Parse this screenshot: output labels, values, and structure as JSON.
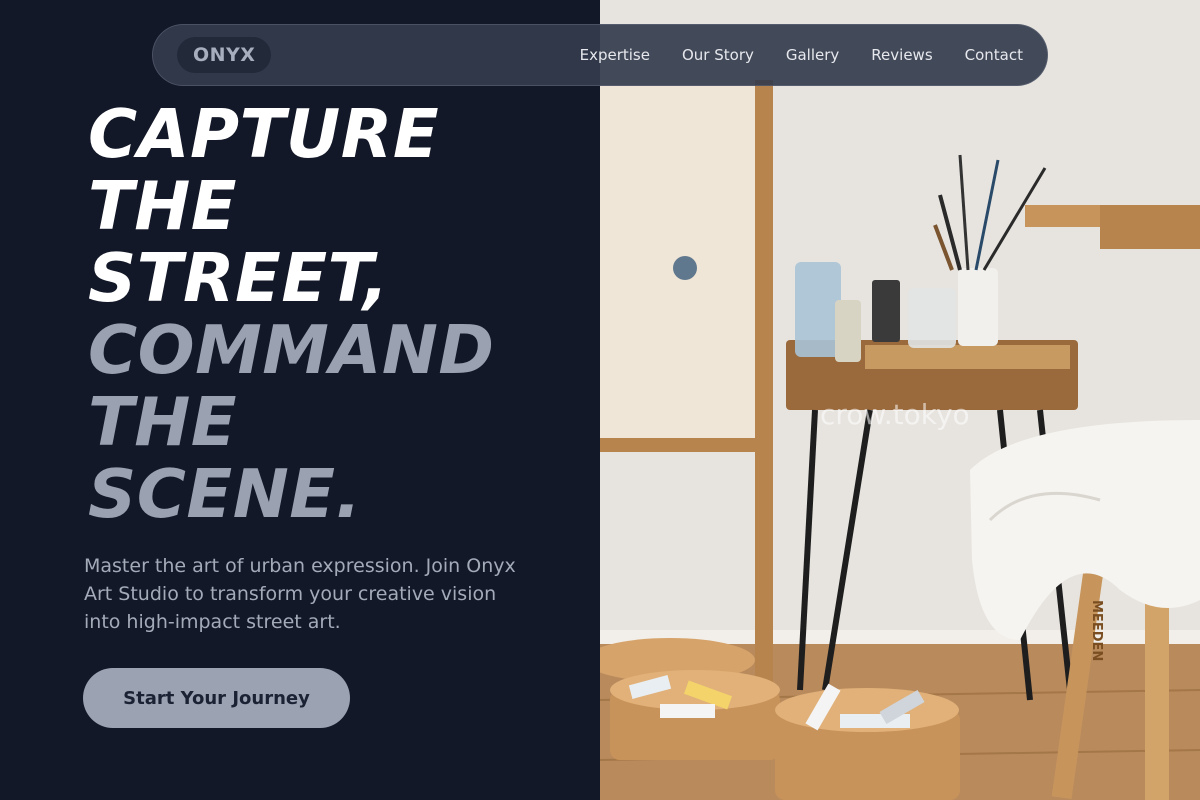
{
  "brand": {
    "logo": "ONYX"
  },
  "nav": {
    "links": [
      "Expertise",
      "Our Story",
      "Gallery",
      "Reviews",
      "Contact"
    ]
  },
  "hero": {
    "headline_light": [
      "CAPTURE",
      "THE",
      "STREET,"
    ],
    "headline_muted": [
      "COMMAND",
      "THE",
      "SCENE."
    ],
    "description": "Master the art of urban expression. Join Onyx Art Studio to transform your creative vision into high-impact street art.",
    "cta_label": "Start Your Journey"
  },
  "photo": {
    "watermark": "crow.tokyo",
    "stool_brand": "MEEDEN"
  },
  "colors": {
    "background": "#131828",
    "headline_light": "#ffffff",
    "headline_muted": "#9aa1b0",
    "cta_bg": "#9ba2b1",
    "nav_bg": "#343c4c"
  }
}
